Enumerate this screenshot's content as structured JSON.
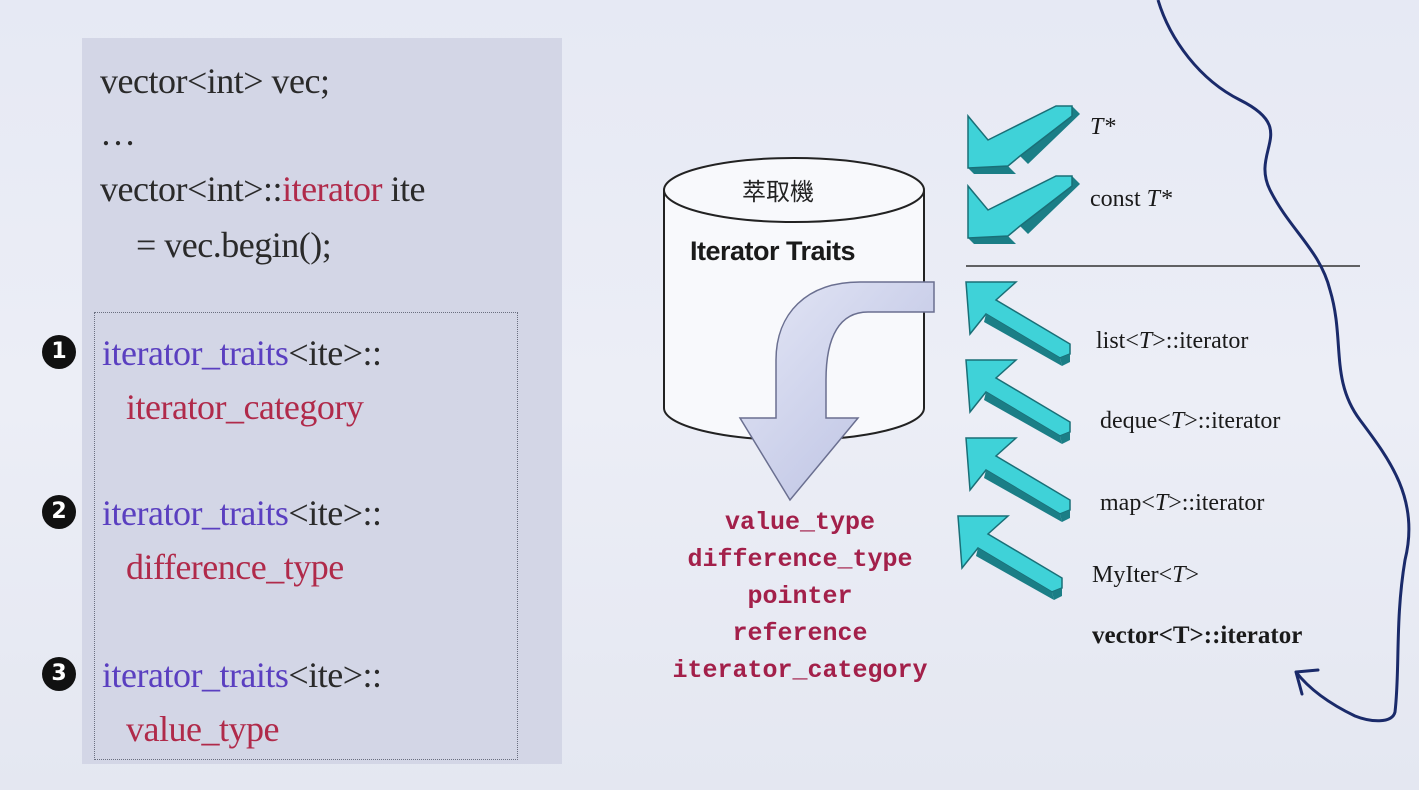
{
  "code": {
    "line1": "vector<int> vec;",
    "line2": "…",
    "line3_pre": "vector<int>::",
    "line3_kw": "iterator",
    "line3_post": " ite",
    "line4": "= vec.begin();"
  },
  "traits": [
    {
      "num": "1",
      "prefix": "iterator_traits",
      "suffix": "<ite>::",
      "member": "iterator_category"
    },
    {
      "num": "2",
      "prefix": "iterator_traits",
      "suffix": "<ite>::",
      "member": "difference_type"
    },
    {
      "num": "3",
      "prefix": "iterator_traits",
      "suffix": "<ite>::",
      "member": "value_type"
    }
  ],
  "cylinder": {
    "title": "萃取機",
    "label": "Iterator Traits"
  },
  "outputs": [
    "value_type",
    "difference_type",
    "pointer",
    "reference",
    "iterator_category"
  ],
  "inputs": {
    "t_ptr": "T*",
    "const_pre": "const ",
    "const_t": "T*",
    "list_pre": "list<",
    "list_t": "T",
    "list_post": ">::iterator",
    "deque_pre": "deque<",
    "deque_t": "T",
    "deque_post": ">::iterator",
    "map_pre": "map<",
    "map_t": "T",
    "map_post": ">::iterator",
    "myiter_pre": "MyIter<",
    "myiter_t": "T",
    "myiter_post": ">",
    "vector_iter": "vector<T>::iterator"
  },
  "colors": {
    "arrow_cyan": "#3fd2d8",
    "arrow_dark": "#1b7e86",
    "output_text": "#a3204a",
    "purple": "#5a3fc0",
    "red": "#b02a4a"
  }
}
